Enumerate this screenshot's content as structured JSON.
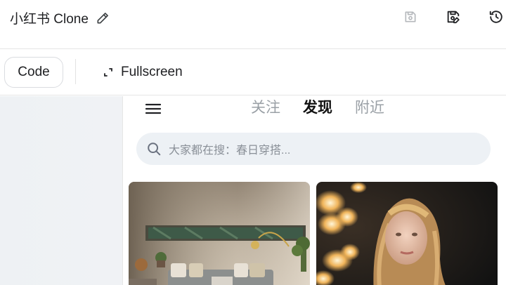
{
  "header": {
    "title": "小红书 Clone",
    "icons": [
      "pencil-icon",
      "save-disabled-icon",
      "save-edit-icon",
      "history-icon"
    ]
  },
  "toolbar": {
    "code_label": "Code",
    "fullscreen_label": "Fullscreen"
  },
  "preview": {
    "tabs": [
      {
        "label": "关注",
        "active": false
      },
      {
        "label": "发现",
        "active": true
      },
      {
        "label": "附近",
        "active": false
      }
    ],
    "search": {
      "placeholder": "大家都在搜：春日穿搭..."
    },
    "cards": [
      {
        "image": "living-room-photo"
      },
      {
        "image": "portrait-woman-curly-hair-photo"
      }
    ]
  },
  "colors": {
    "accent_active_tab": "#111111",
    "inactive_tab": "#9aa0a6",
    "search_bg": "#edf1f5",
    "border": "#e5e5e5"
  }
}
